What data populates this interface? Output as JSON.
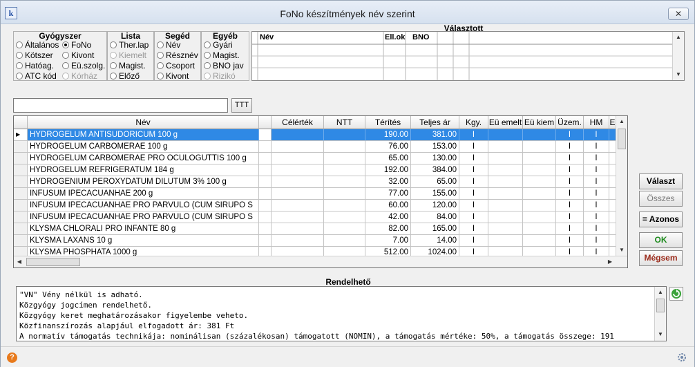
{
  "window": {
    "title": "FoNo készítmények név szerint",
    "close_label": "✕"
  },
  "groups": {
    "gyogyszer": {
      "title": "Gyógyszer",
      "options": [
        {
          "label": "Általános",
          "checked": false,
          "disabled": false
        },
        {
          "label": "FoNo",
          "checked": true,
          "disabled": false
        },
        {
          "label": "Kötszer",
          "checked": false,
          "disabled": false
        },
        {
          "label": "Kivont",
          "checked": false,
          "disabled": false
        },
        {
          "label": "Hatóag.",
          "checked": false,
          "disabled": false
        },
        {
          "label": "Eü.szolg.",
          "checked": false,
          "disabled": false
        },
        {
          "label": "ATC kód",
          "checked": false,
          "disabled": false
        },
        {
          "label": "Kórház",
          "checked": false,
          "disabled": true
        }
      ]
    },
    "lista": {
      "title": "Lista",
      "options": [
        {
          "label": "Ther.lap",
          "checked": false,
          "disabled": false
        },
        {
          "label": "Kiemelt",
          "checked": false,
          "disabled": true
        },
        {
          "label": "Magist.",
          "checked": false,
          "disabled": false
        },
        {
          "label": "Előző",
          "checked": false,
          "disabled": false
        }
      ]
    },
    "seged": {
      "title": "Segéd",
      "options": [
        {
          "label": "Név",
          "checked": false,
          "disabled": false
        },
        {
          "label": "Résznév",
          "checked": false,
          "disabled": false
        },
        {
          "label": "Csoport",
          "checked": false,
          "disabled": false
        },
        {
          "label": "Kivont",
          "checked": false,
          "disabled": false
        }
      ]
    },
    "egyeb": {
      "title": "Egyéb",
      "options": [
        {
          "label": "Gyári",
          "checked": false,
          "disabled": false
        },
        {
          "label": "Magist.",
          "checked": false,
          "disabled": false
        },
        {
          "label": "BNO jav",
          "checked": false,
          "disabled": false
        },
        {
          "label": "Rizikó",
          "checked": false,
          "disabled": true
        }
      ]
    }
  },
  "valasztott": {
    "title": "Választott",
    "columns": [
      "Név",
      "Ell.ok",
      "BNO"
    ]
  },
  "filter": {
    "value": "",
    "ttt_label": "TTT"
  },
  "grid": {
    "columns": [
      "Név",
      "",
      "Célérték",
      "NTT",
      "Térítés",
      "Teljes ár",
      "Kgy.",
      "Eü emelt",
      "Eü kiem",
      "Üzem.",
      "HM",
      "E"
    ],
    "rows": [
      {
        "name": "HYDROGELUM ANTISUDORICUM 100 g",
        "celertek": "",
        "ntt": "",
        "terites": "190.00",
        "teljes": "381.00",
        "kgy": "I",
        "eu_emelt": "",
        "eu_kiem": "",
        "uzem": "I",
        "hm": "I",
        "selected": true
      },
      {
        "name": "HYDROGELUM CARBOMERAE 100 g",
        "celertek": "",
        "ntt": "",
        "terites": "76.00",
        "teljes": "153.00",
        "kgy": "I",
        "eu_emelt": "",
        "eu_kiem": "",
        "uzem": "I",
        "hm": "I",
        "selected": false
      },
      {
        "name": "HYDROGELUM CARBOMERAE PRO OCULOGUTTIS 100 g",
        "celertek": "",
        "ntt": "",
        "terites": "65.00",
        "teljes": "130.00",
        "kgy": "I",
        "eu_emelt": "",
        "eu_kiem": "",
        "uzem": "I",
        "hm": "I",
        "selected": false
      },
      {
        "name": "HYDROGELUM REFRIGERATUM 184 g",
        "celertek": "",
        "ntt": "",
        "terites": "192.00",
        "teljes": "384.00",
        "kgy": "I",
        "eu_emelt": "",
        "eu_kiem": "",
        "uzem": "I",
        "hm": "I",
        "selected": false
      },
      {
        "name": "HYDROGENIUM PEROXYDATUM DILUTUM 3% 100 g",
        "celertek": "",
        "ntt": "",
        "terites": "32.00",
        "teljes": "65.00",
        "kgy": "I",
        "eu_emelt": "",
        "eu_kiem": "",
        "uzem": "I",
        "hm": "I",
        "selected": false
      },
      {
        "name": "INFUSUM IPECACUANHAE 200 g",
        "celertek": "",
        "ntt": "",
        "terites": "77.00",
        "teljes": "155.00",
        "kgy": "I",
        "eu_emelt": "",
        "eu_kiem": "",
        "uzem": "I",
        "hm": "I",
        "selected": false
      },
      {
        "name": "INFUSUM IPECACUANHAE PRO PARVULO (CUM SIRUPO S",
        "celertek": "",
        "ntt": "",
        "terites": "60.00",
        "teljes": "120.00",
        "kgy": "I",
        "eu_emelt": "",
        "eu_kiem": "",
        "uzem": "I",
        "hm": "I",
        "selected": false
      },
      {
        "name": "INFUSUM IPECACUANHAE PRO PARVULO (CUM SIRUPO S",
        "celertek": "",
        "ntt": "",
        "terites": "42.00",
        "teljes": "84.00",
        "kgy": "I",
        "eu_emelt": "",
        "eu_kiem": "",
        "uzem": "I",
        "hm": "I",
        "selected": false
      },
      {
        "name": "KLYSMA CHLORALI PRO INFANTE 80 g",
        "celertek": "",
        "ntt": "",
        "terites": "82.00",
        "teljes": "165.00",
        "kgy": "I",
        "eu_emelt": "",
        "eu_kiem": "",
        "uzem": "I",
        "hm": "I",
        "selected": false
      },
      {
        "name": "KLYSMA LAXANS 10 g",
        "celertek": "",
        "ntt": "",
        "terites": "7.00",
        "teljes": "14.00",
        "kgy": "I",
        "eu_emelt": "",
        "eu_kiem": "",
        "uzem": "I",
        "hm": "I",
        "selected": false
      },
      {
        "name": "KLYSMA PHOSPHATA 1000 g",
        "celertek": "",
        "ntt": "",
        "terites": "512.00",
        "teljes": "1024.00",
        "kgy": "I",
        "eu_emelt": "",
        "eu_kiem": "",
        "uzem": "I",
        "hm": "I",
        "selected": false
      }
    ]
  },
  "buttons": {
    "valaszt": "Választ",
    "osszes": "Összes",
    "azonos": "= Azonos",
    "ok": "OK",
    "megsem": "Mégsem"
  },
  "rendelheto": {
    "title": "Rendelhető",
    "lines": [
      "\"VN\" Vény nélkül is adható.",
      "Közgyógy jogcímen rendelhető.",
      "Közgyógy keret meghatározásakor figyelembe veheto.",
      "Közfinanszírozás alapjául elfogadott ár: 381 Ft",
      "A normatív támogatás technikája: nominálisan (százalékosan) támogatott (NOMIN), a támogatás mértéke: 50%, a támogatás összege: 191"
    ]
  },
  "status": {
    "help_label": "?"
  },
  "colors": {
    "selection": "#2f89e5",
    "ok": "#1d8a1d",
    "cancel": "#9a2a1a",
    "help": "#e87a1c"
  }
}
